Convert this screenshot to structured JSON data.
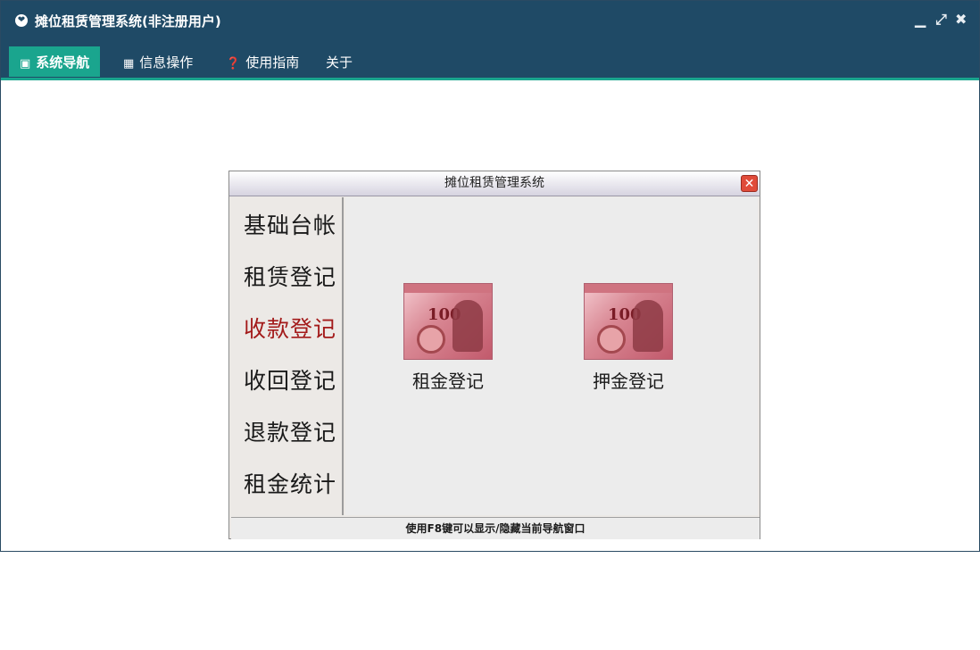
{
  "window": {
    "title": "摊位租赁管理系统(非注册用户)",
    "logo_icon": "logo-icon",
    "controls": {
      "minimize": "▁",
      "restore": "⤢",
      "close": "✖"
    }
  },
  "menubar": {
    "items": [
      {
        "label": "系统导航",
        "icon": "monitor-icon",
        "active": true
      },
      {
        "label": "信息操作",
        "icon": "grid-icon",
        "active": false
      },
      {
        "label": "使用指南",
        "icon": "help-icon",
        "active": false
      },
      {
        "label": "关于",
        "icon": "",
        "active": false
      }
    ]
  },
  "dialog": {
    "title": "摊位租赁管理系统",
    "nav": [
      {
        "label": "基础台帐",
        "selected": false
      },
      {
        "label": "租赁登记",
        "selected": false
      },
      {
        "label": "收款登记",
        "selected": true
      },
      {
        "label": "收回登记",
        "selected": false
      },
      {
        "label": "退款登记",
        "selected": false
      },
      {
        "label": "租金统计",
        "selected": false
      }
    ],
    "tiles": [
      {
        "label": "租金登记",
        "note_value": "100"
      },
      {
        "label": "押金登记",
        "note_value": "100"
      }
    ],
    "status": "使用F8键可以显示/隐藏当前导航窗口"
  },
  "colors": {
    "titlebar": "#1f4a66",
    "accent": "#1aa58e",
    "selected_nav": "#a31a1a"
  }
}
